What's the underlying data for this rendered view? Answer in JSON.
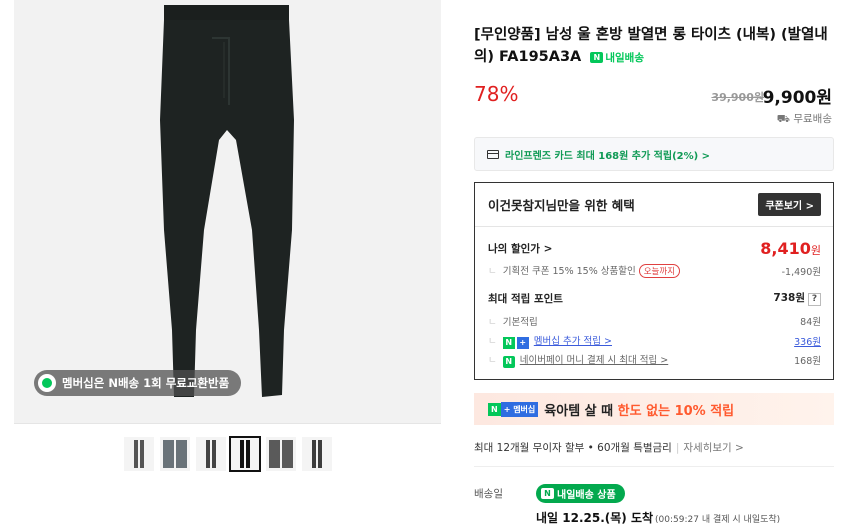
{
  "gallery": {
    "promo_text": "멤버십은 N배송 1회 무료교환반품",
    "thumbnail_count": 6,
    "selected_thumbnail": 4
  },
  "product": {
    "title": "[무인양품] 남성 울 혼방 발열면 롱 타이츠 (내복) (발열내의) FA195A3A",
    "delivery_tag": "내일배송"
  },
  "price": {
    "discount_rate": "78%",
    "original": "39,900원",
    "sale": "9,900원",
    "shipping": "무료배송"
  },
  "card_promo": "라인프렌즈 카드 최대 168원 추가 적립(2%) >",
  "benefit": {
    "title": "이건못참지님만을 위한 혜택",
    "coupon_button": "쿠폰보기 >",
    "my_discount_label": "나의 할인가 >",
    "my_discount_value": "8,410",
    "my_discount_unit": "원",
    "coupon_line": "기획전 쿠폰 15% 15% 상품할인",
    "coupon_tag": "오늘까지",
    "coupon_amount": "-1,490원",
    "max_point_label": "최대 적립 포인트",
    "max_point_value": "738원",
    "basic_label": "기본적립",
    "basic_value": "84원",
    "membership_label": "멤버십 추가 적립 >",
    "membership_value": "336원",
    "naverpay_label": "네이버페이 머니 결제 시 최대 적립 >",
    "naverpay_value": "168원"
  },
  "banner": {
    "badge_n": "N",
    "badge_membership": "+ 멤버십",
    "text_a": "육아템 살 때 ",
    "text_b": "한도 없는 10% 적립"
  },
  "installment": {
    "text": "최대 12개월 무이자 할부 • 60개월 특별금리",
    "more": "자세히보기 >"
  },
  "delivery": {
    "label": "배송일",
    "badge": "내일배송 상품",
    "arrive": "내일 12.25.(목) 도착",
    "arrive_note": "(00:59:27 내 결제 시 내일도착)"
  },
  "colors": {
    "naver_green": "#03c75a",
    "sale_red": "#e02020",
    "accent_orange": "#ff5a2f"
  }
}
